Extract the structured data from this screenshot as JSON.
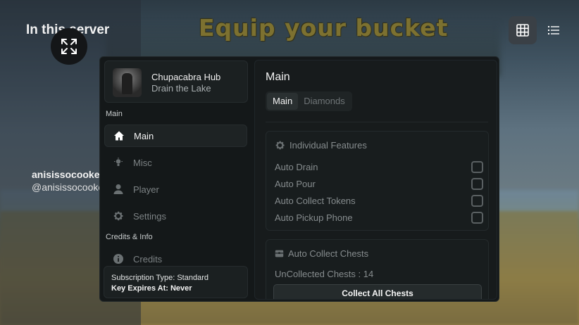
{
  "background": {
    "server_title": "In this server",
    "banner_text": "Equip your bucket",
    "user_display_name": "anisissocooke",
    "user_handle": "@anisissocooke"
  },
  "hub": {
    "title": "Chupacabra Hub",
    "subtitle": "Drain the Lake"
  },
  "sidebar": {
    "section_main": "Main",
    "items": [
      {
        "label": "Main",
        "icon": "home-icon"
      },
      {
        "label": "Misc",
        "icon": "bulb-icon"
      },
      {
        "label": "Player",
        "icon": "person-icon"
      },
      {
        "label": "Settings",
        "icon": "gear-icon"
      }
    ],
    "section_credits": "Credits & Info",
    "credits_item": {
      "label": "Credits",
      "icon": "info-icon"
    },
    "subscription_type": "Subscription Type: Standard",
    "key_expires": "Key Expires At: Never"
  },
  "content": {
    "title": "Main",
    "tabs": [
      {
        "label": "Main",
        "active": true
      },
      {
        "label": "Diamonds",
        "active": false
      }
    ],
    "individual_features": {
      "header": "Individual Features",
      "options": [
        {
          "label": "Auto Drain",
          "checked": false
        },
        {
          "label": "Auto Pour",
          "checked": false
        },
        {
          "label": "Auto Collect Tokens",
          "checked": false
        },
        {
          "label": "Auto Pickup Phone",
          "checked": false
        }
      ]
    },
    "chests": {
      "header": "Auto Collect Chests",
      "uncollected": "UnCollected Chests : 14",
      "button_label": "Collect All Chests"
    }
  },
  "colors": {
    "window_bg": "#141819",
    "active_text": "#f4f4f4",
    "muted_text": "#868c8e"
  }
}
